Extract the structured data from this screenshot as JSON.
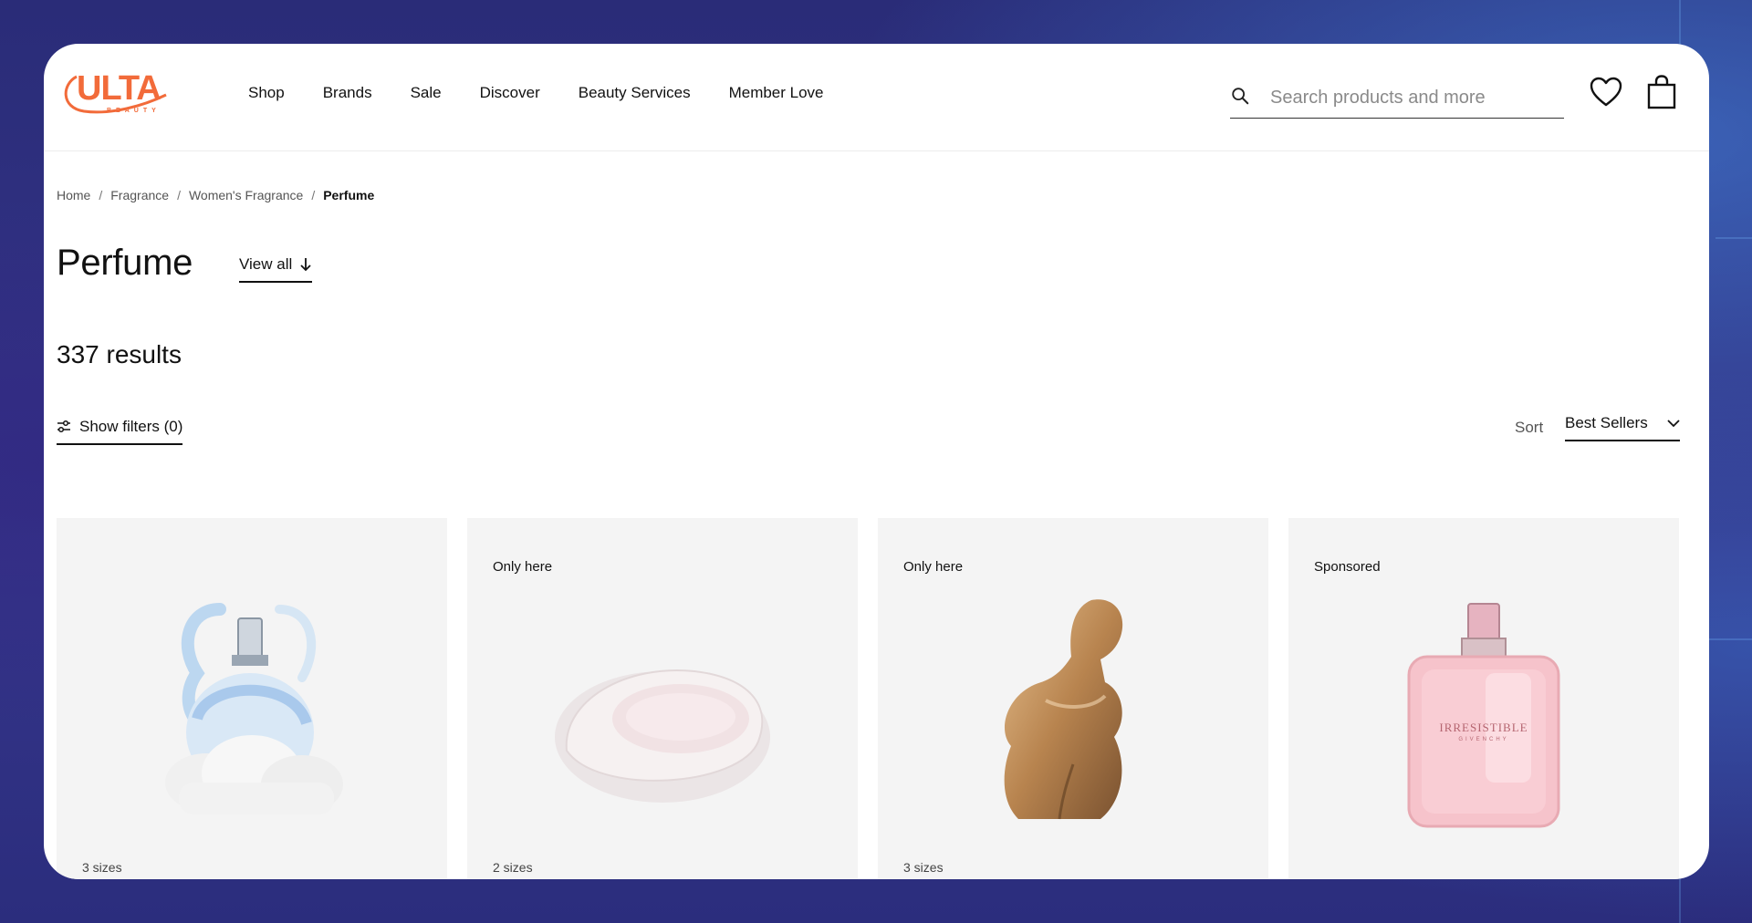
{
  "header": {
    "logo_text": "ULTA",
    "logo_sub": "BEAUTY",
    "nav": [
      "Shop",
      "Brands",
      "Sale",
      "Discover",
      "Beauty Services",
      "Member Love"
    ],
    "search_placeholder": "Search products and more"
  },
  "breadcrumb": {
    "items": [
      "Home",
      "Fragrance",
      "Women's Fragrance"
    ],
    "current": "Perfume",
    "separator": "/"
  },
  "page": {
    "title": "Perfume",
    "view_all": "View all",
    "results": "337 results",
    "filters_label": "Show filters (0)",
    "sort_label": "Sort",
    "sort_value": "Best Sellers"
  },
  "products": [
    {
      "badge": "",
      "sizes": "3 sizes",
      "icon": "cloud-perfume-bottle"
    },
    {
      "badge": "Only here",
      "sizes": "2 sizes",
      "icon": "pebble-perfume-bottle"
    },
    {
      "badge": "Only here",
      "sizes": "3 sizes",
      "icon": "gold-torso-perfume-bottle"
    },
    {
      "badge": "Sponsored",
      "sizes": "",
      "icon": "pink-square-perfume-bottle",
      "label": "IRRESISTIBLE",
      "label_sub": "GIVENCHY"
    }
  ],
  "colors": {
    "brand": "#f26b3a",
    "text": "#111111",
    "card_bg": "#f4f4f4"
  }
}
